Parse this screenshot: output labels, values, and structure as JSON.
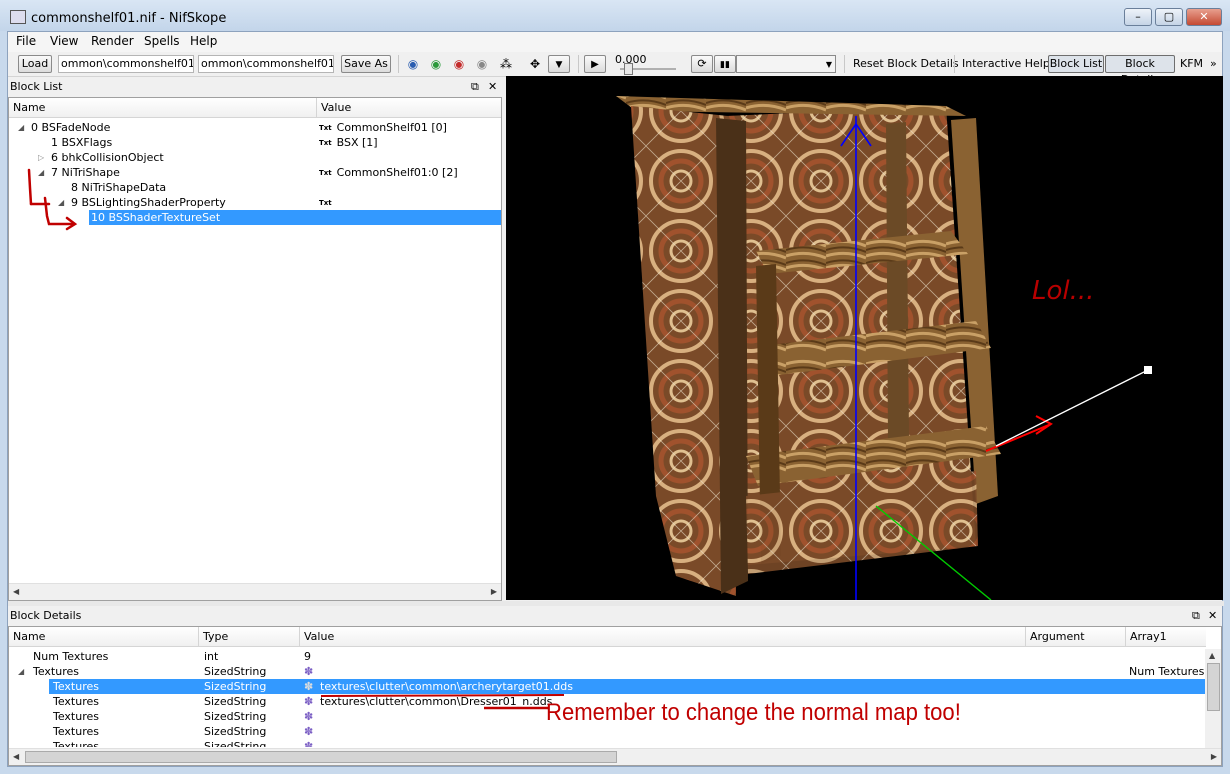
{
  "window": {
    "title": "commonshelf01.nif - NifSkope",
    "minimize": "–",
    "maximize": "▢",
    "close": "✕"
  },
  "menu": [
    "File",
    "View",
    "Render",
    "Spells",
    "Help"
  ],
  "toolbar": {
    "load_label": "Load",
    "load_path": "ommon\\commonshelf01.nif",
    "save_path": "ommon\\commonshelf01.nif",
    "save_label": "Save As",
    "anim_time": "0.000",
    "reset_label": "Reset Block Details",
    "help_label": "Interactive Help",
    "block_list_label": "Block List",
    "block_details_label": "Block Details",
    "kfm_label": "KFM",
    "more": "»"
  },
  "block_list": {
    "title": "Block List",
    "columns": {
      "name": "Name",
      "value": "Value"
    },
    "rows": [
      {
        "name": "0 BSFadeNode",
        "badge": "Txt",
        "value": "CommonShelf01 [0]"
      },
      {
        "name": "1 BSXFlags",
        "badge": "Txt",
        "value": "BSX [1]"
      },
      {
        "name": "6 bhkCollisionObject",
        "badge": "",
        "value": ""
      },
      {
        "name": "7 NiTriShape",
        "badge": "Txt",
        "value": "CommonShelf01:0 [2]"
      },
      {
        "name": "8 NiTriShapeData",
        "badge": "",
        "value": ""
      },
      {
        "name": "9 BSLightingShaderProperty",
        "badge": "Txt",
        "value": ""
      },
      {
        "name": "10 BSShaderTextureSet",
        "badge": "",
        "value": ""
      }
    ]
  },
  "viewport": {
    "annotation": "Lol..."
  },
  "block_details": {
    "title": "Block Details",
    "columns": {
      "name": "Name",
      "type": "Type",
      "value": "Value",
      "argument": "Argument",
      "array1": "Array1"
    },
    "rows": [
      {
        "name": "Num Textures",
        "type": "int",
        "value": "9",
        "array1": ""
      },
      {
        "name": "Textures",
        "type": "SizedString",
        "value": "",
        "array1": "Num Textures"
      },
      {
        "name": "Textures",
        "type": "SizedString",
        "value": "textures\\clutter\\common\\archerytarget01.dds",
        "array1": ""
      },
      {
        "name": "Textures",
        "type": "SizedString",
        "value": "textures\\clutter\\common\\Dresser01_n.dds",
        "array1": ""
      },
      {
        "name": "Textures",
        "type": "SizedString",
        "value": "",
        "array1": ""
      },
      {
        "name": "Textures",
        "type": "SizedString",
        "value": "",
        "array1": ""
      },
      {
        "name": "Textures",
        "type": "SizedString",
        "value": "",
        "array1": ""
      }
    ],
    "annotation": "Remember to change the normal map too!"
  },
  "colors": {
    "selection": "#3399ff",
    "annotation_red": "#c00000",
    "viewport_bg": "#000000"
  }
}
